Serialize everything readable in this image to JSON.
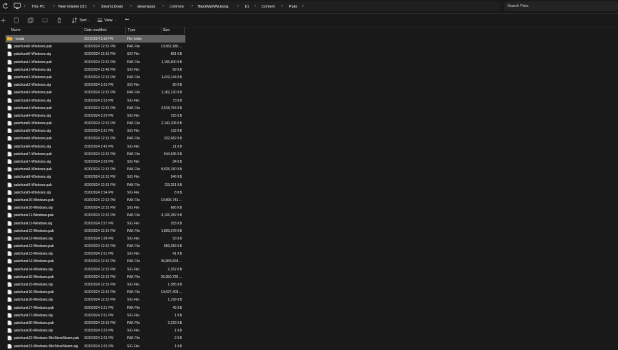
{
  "address": {
    "crumbs": [
      "This PC",
      "New Volume (D:)",
      "SteamLibrary",
      "steamapps",
      "common",
      "BlackMythWukong",
      "b1",
      "Content",
      "Paks"
    ]
  },
  "search": {
    "placeholder": "Search Paks"
  },
  "toolbar": {
    "sort_label": "Sort",
    "view_label": "View",
    "more_label": "•••"
  },
  "columns": {
    "name": "Name",
    "date": "Date modified",
    "type": "Type",
    "size": "Size"
  },
  "icons": {
    "folder": "folder-icon",
    "file": "file-icon",
    "back": "back-arrow-icon",
    "pc": "computer-icon"
  },
  "files": [
    {
      "name": "~mods",
      "date": "8/21/2024 3:30 PM",
      "type": "File folder",
      "size": "",
      "folder": true
    },
    {
      "name": "pakchunk0-Windows.pak",
      "date": "8/20/2024 12:33 PM",
      "type": "PAK File",
      "size": "13,562,180 ..."
    },
    {
      "name": "pakchunk0-Windows.sig",
      "date": "8/20/2024 12:33 PM",
      "type": "SIG File",
      "size": "851 KB"
    },
    {
      "name": "pakchunk1-Windows.pak",
      "date": "8/20/2024 12:33 PM",
      "type": "PAK File",
      "size": "1,106,600 KB"
    },
    {
      "name": "pakchunk1-Windows.sig",
      "date": "8/20/2024 12:48 PM",
      "type": "SIG File",
      "size": "69 KB"
    },
    {
      "name": "pakchunk2-Windows.pak",
      "date": "8/20/2024 12:33 PM",
      "type": "PAK File",
      "size": "1,419,144 KB"
    },
    {
      "name": "pakchunk2-Windows.sig",
      "date": "8/20/2024 3:25 PM",
      "type": "SIG File",
      "size": "90 KB"
    },
    {
      "name": "pakchunk3-Windows.pak",
      "date": "8/20/2024 12:33 PM",
      "type": "PAK File",
      "size": "1,162,120 KB"
    },
    {
      "name": "pakchunk3-Windows.sig",
      "date": "8/20/2024 2:53 PM",
      "type": "SIG File",
      "size": "73 KB"
    },
    {
      "name": "pakchunk4-Windows.pak",
      "date": "8/20/2024 12:33 PM",
      "type": "PAK File",
      "size": "2,518,764 KB"
    },
    {
      "name": "pakchunk4-Windows.sig",
      "date": "8/20/2024 3:29 PM",
      "type": "SIG File",
      "size": "155 KB"
    },
    {
      "name": "pakchunk5-Windows.pak",
      "date": "8/20/2024 12:33 PM",
      "type": "PAK File",
      "size": "2,140,108 KB"
    },
    {
      "name": "pakchunk5-Windows.sig",
      "date": "8/20/2024 2:31 PM",
      "type": "SIG File",
      "size": "132 KB"
    },
    {
      "name": "pakchunk6-Windows.pak",
      "date": "8/20/2024 12:33 PM",
      "type": "PAK File",
      "size": "322,682 KB"
    },
    {
      "name": "pakchunk6-Windows.sig",
      "date": "8/20/2024 2:45 PM",
      "type": "SIG File",
      "size": "21 KB"
    },
    {
      "name": "pakchunk7-Windows.pak",
      "date": "8/20/2024 12:33 PM",
      "type": "PAK File",
      "size": "544,635 KB"
    },
    {
      "name": "pakchunk7-Windows.sig",
      "date": "8/20/2024 3:28 PM",
      "type": "SIG File",
      "size": "34 KB"
    },
    {
      "name": "pakchunk8-Windows.pak",
      "date": "8/20/2024 12:33 PM",
      "type": "PAK File",
      "size": "8,925,150 KB"
    },
    {
      "name": "pakchunk8-Windows.sig",
      "date": "8/20/2024 12:33 PM",
      "type": "SIG File",
      "size": "546 KB"
    },
    {
      "name": "pakchunk9-Windows.pak",
      "date": "8/20/2024 12:33 PM",
      "type": "PAK File",
      "size": "119,251 KB"
    },
    {
      "name": "pakchunk9-Windows.sig",
      "date": "8/20/2024 2:54 PM",
      "type": "SIG File",
      "size": "8 KB"
    },
    {
      "name": "pakchunk10-Windows.pak",
      "date": "8/20/2024 12:33 PM",
      "type": "PAK File",
      "size": "10,896,741 ..."
    },
    {
      "name": "pakchunk10-Windows.sig",
      "date": "8/20/2024 12:33 PM",
      "type": "SIG File",
      "size": "666 KB"
    },
    {
      "name": "pakchunk11-Windows.pak",
      "date": "8/20/2024 12:33 PM",
      "type": "PAK File",
      "size": "4,126,382 KB"
    },
    {
      "name": "pakchunk11-Windows.sig",
      "date": "8/20/2024 2:57 PM",
      "type": "SIG File",
      "size": "253 KB"
    },
    {
      "name": "pakchunk12-Windows.pak",
      "date": "8/20/2024 12:33 PM",
      "type": "PAK File",
      "size": "1,509,078 KB"
    },
    {
      "name": "pakchunk12-Windows.sig",
      "date": "8/20/2024 1:08 PM",
      "type": "SIG File",
      "size": "93 KB"
    },
    {
      "name": "pakchunk13-Windows.pak",
      "date": "8/20/2024 12:33 PM",
      "type": "PAK File",
      "size": "659,283 KB"
    },
    {
      "name": "pakchunk13-Windows.sig",
      "date": "8/20/2024 2:51 PM",
      "type": "SIG File",
      "size": "41 KB"
    },
    {
      "name": "pakchunk14-Windows.pak",
      "date": "8/20/2024 12:33 PM",
      "type": "PAK File",
      "size": "36,883,824 ..."
    },
    {
      "name": "pakchunk14-Windows.sig",
      "date": "8/20/2024 12:33 PM",
      "type": "SIG File",
      "size": "2,252 KB"
    },
    {
      "name": "pakchunk15-Windows.pak",
      "date": "8/20/2024 12:33 PM",
      "type": "PAK File",
      "size": "25,950,726 ..."
    },
    {
      "name": "pakchunk15-Windows.sig",
      "date": "8/20/2024 12:33 PM",
      "type": "SIG File",
      "size": "1,585 KB"
    },
    {
      "name": "pakchunk16-Windows.pak",
      "date": "8/20/2024 12:33 PM",
      "type": "PAK File",
      "size": "19,627,403 ..."
    },
    {
      "name": "pakchunk16-Windows.sig",
      "date": "8/20/2024 12:33 PM",
      "type": "SIG File",
      "size": "1,199 KB"
    },
    {
      "name": "pakchunk17-Windows.pak",
      "date": "8/20/2024 2:21 PM",
      "type": "PAK File",
      "size": "45 KB"
    },
    {
      "name": "pakchunk17-Windows.sig",
      "date": "8/20/2024 2:51 PM",
      "type": "SIG File",
      "size": "1 KB"
    },
    {
      "name": "pakchunk20-Windows.pak",
      "date": "8/20/2024 12:33 PM",
      "type": "PAK File",
      "size": "2,229 KB"
    },
    {
      "name": "pakchunk20-Windows.sig",
      "date": "8/20/2024 3:25 PM",
      "type": "SIG File",
      "size": "1 KB"
    },
    {
      "name": "pakchunk23-Windows-WinStoreSteam.pak",
      "date": "8/20/2024 2:25 PM",
      "type": "PAK File",
      "size": "2 KB"
    },
    {
      "name": "pakchunk23-Windows-WinStoreSteam.sig",
      "date": "8/20/2024 3:25 PM",
      "type": "SIG File",
      "size": "1 KB"
    }
  ]
}
